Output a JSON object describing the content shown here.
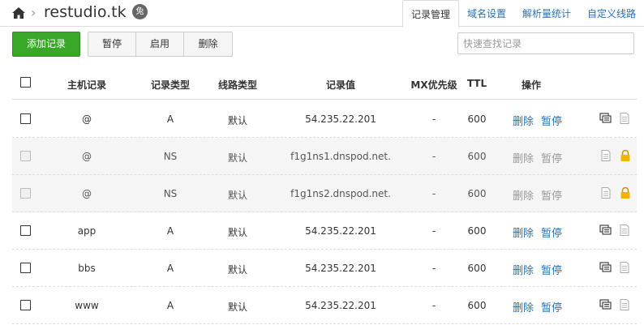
{
  "header": {
    "domain": "restudio.tk",
    "badge_char": "兔",
    "tabs": [
      {
        "label": "记录管理",
        "active": true
      },
      {
        "label": "域名设置",
        "active": false
      },
      {
        "label": "解析量统计",
        "active": false
      },
      {
        "label": "自定义线路",
        "active": false
      }
    ]
  },
  "toolbar": {
    "add_label": "添加记录",
    "pause_label": "暂停",
    "enable_label": "启用",
    "delete_label": "删除",
    "search_placeholder": "快速查找记录"
  },
  "table": {
    "columns": [
      "主机记录",
      "记录类型",
      "线路类型",
      "记录值",
      "MX优先级",
      "TTL",
      "操作"
    ],
    "delete_label": "删除",
    "pause_label": "暂停",
    "rows": [
      {
        "host": "@",
        "type": "A",
        "line": "默认",
        "value": "54.235.22.201",
        "mx": "-",
        "ttl": "600",
        "system": false
      },
      {
        "host": "@",
        "type": "NS",
        "line": "默认",
        "value": "f1g1ns1.dnspod.net.",
        "mx": "-",
        "ttl": "600",
        "system": true
      },
      {
        "host": "@",
        "type": "NS",
        "line": "默认",
        "value": "f1g1ns2.dnspod.net.",
        "mx": "-",
        "ttl": "600",
        "system": true
      },
      {
        "host": "app",
        "type": "A",
        "line": "默认",
        "value": "54.235.22.201",
        "mx": "-",
        "ttl": "600",
        "system": false
      },
      {
        "host": "bbs",
        "type": "A",
        "line": "默认",
        "value": "54.235.22.201",
        "mx": "-",
        "ttl": "600",
        "system": false
      },
      {
        "host": "www",
        "type": "A",
        "line": "默认",
        "value": "54.235.22.201",
        "mx": "-",
        "ttl": "600",
        "system": false
      }
    ]
  },
  "colors": {
    "link": "#2a72b5",
    "add_button": "#39a829",
    "lock": "#f0b400"
  }
}
